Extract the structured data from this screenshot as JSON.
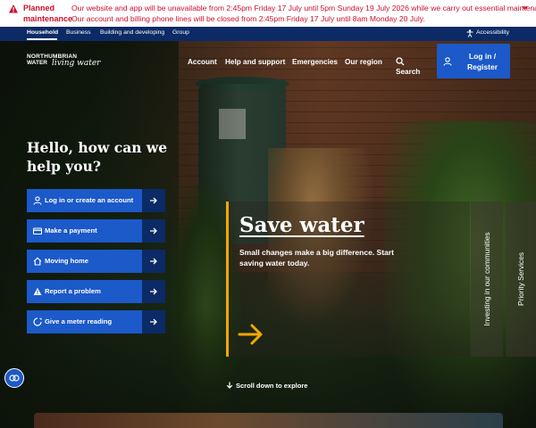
{
  "alert": {
    "title_line1": "Planned",
    "title_line2": "maintenance",
    "message_line1": "Our website and app will be unavailable from 2:45pm Friday 17 July until 5pm Sunday 19 July 2026 while we carry out essential maintenance.",
    "message_line2": "Our account and billing phone lines will be closed from 2:45pm Friday 17 July until 8am Monday 20 July.",
    "icon": "warning-triangle-icon",
    "toggle_icon": "chevron-down-icon",
    "color": "#c8102e"
  },
  "topbar": {
    "items": [
      "Household",
      "Business",
      "Building and developing",
      "Group"
    ],
    "active": "Household",
    "accessibility": "Accessibility",
    "accessibility_icon": "accessibility-icon",
    "background": "#0b2a66"
  },
  "brand": {
    "line1": "NORTHUMBRIAN",
    "line2": "WATER",
    "script": "living water"
  },
  "mainnav": {
    "items": [
      "Account",
      "Help and support",
      "Emergencies",
      "Our region"
    ],
    "search": "Search",
    "login_line1": "Log in /",
    "login_line2": "Register",
    "login_color": "#1c59c9"
  },
  "hero": {
    "greeting": "Hello, how can we help you?",
    "actions": [
      {
        "label": "Log in or create an account",
        "icon": "user-icon"
      },
      {
        "label": "Make a payment",
        "icon": "card-icon"
      },
      {
        "label": "Moving home",
        "icon": "home-icon"
      },
      {
        "label": "Report a problem",
        "icon": "warning-icon"
      },
      {
        "label": "Give a meter reading",
        "icon": "meter-icon"
      }
    ],
    "feature": {
      "title": "Save water",
      "text": "Small changes make a big difference. Start saving water today.",
      "accent": "#f2a900"
    },
    "side_tabs": [
      "Investing in our communities",
      "Priority Services"
    ],
    "scroll": "Scroll down to explore"
  }
}
